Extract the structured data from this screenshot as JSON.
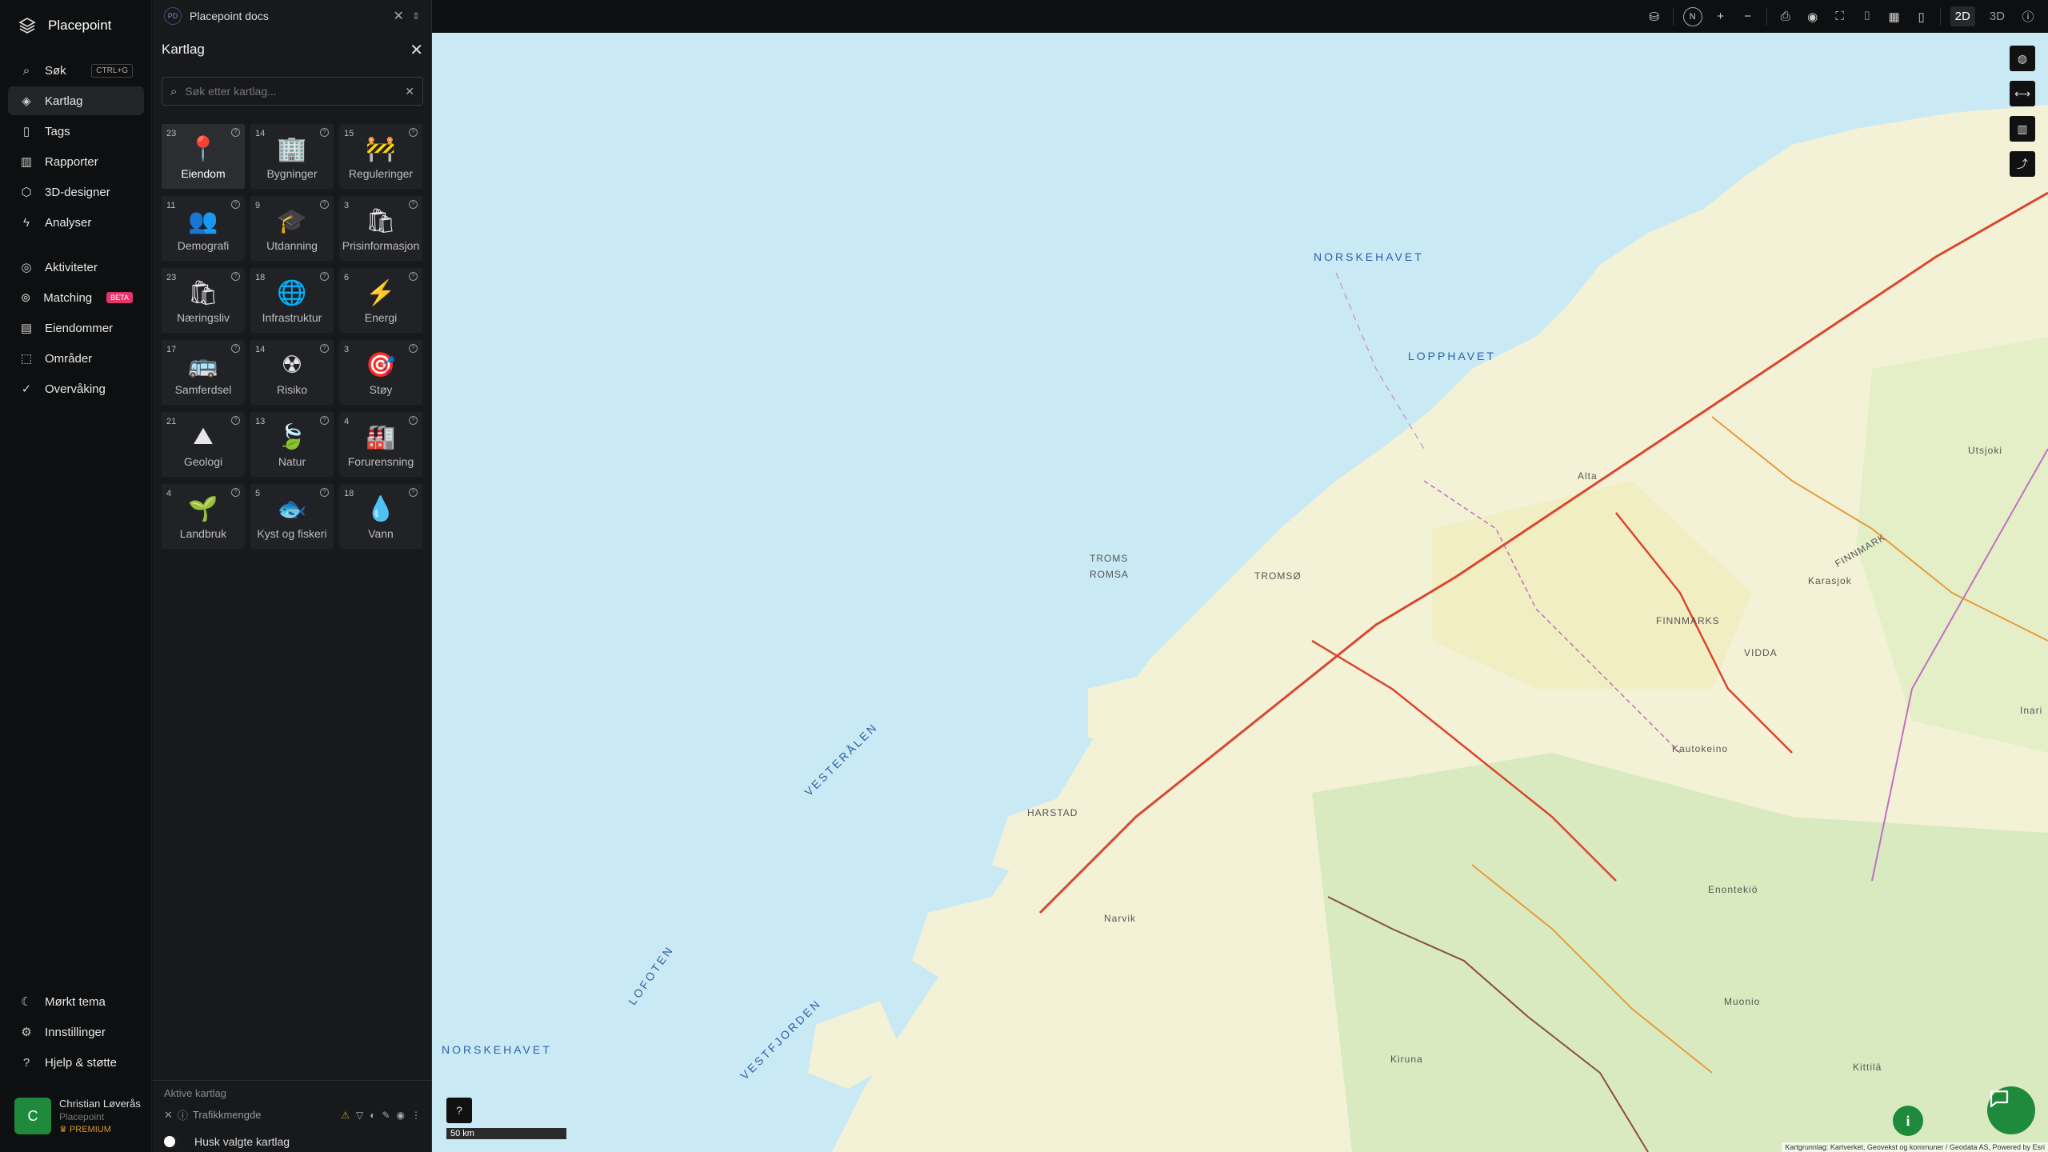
{
  "app": {
    "brand": "Placepoint"
  },
  "nav": {
    "items": [
      {
        "label": "Søk",
        "icon": "search-icon",
        "kbd": "CTRL+G"
      },
      {
        "label": "Kartlag",
        "icon": "layers-icon",
        "active": true
      },
      {
        "label": "Tags",
        "icon": "bookmark-icon"
      },
      {
        "label": "Rapporter",
        "icon": "chart-icon"
      },
      {
        "label": "3D-designer",
        "icon": "cube-icon"
      },
      {
        "label": "Analyser",
        "icon": "bolt-icon"
      }
    ],
    "items2": [
      {
        "label": "Aktiviteter",
        "icon": "activity-icon"
      },
      {
        "label": "Matching",
        "icon": "target-icon",
        "badge": "BETA"
      },
      {
        "label": "Eiendommer",
        "icon": "building-icon"
      },
      {
        "label": "Områder",
        "icon": "area-icon"
      },
      {
        "label": "Overvåking",
        "icon": "check-circle-icon"
      }
    ],
    "bottom": [
      {
        "label": "Mørkt tema",
        "icon": "moon-icon"
      },
      {
        "label": "Innstillinger",
        "icon": "gear-icon"
      },
      {
        "label": "Hjelp & støtte",
        "icon": "help-icon"
      }
    ]
  },
  "user": {
    "initial": "C",
    "name": "Christian Løverås",
    "org": "Placepoint",
    "plan": "PREMIUM"
  },
  "panel": {
    "doc": {
      "badge": "PD",
      "title": "Placepoint docs"
    },
    "title": "Kartlag",
    "search_placeholder": "Søk etter kartlag...",
    "categories": [
      {
        "count": "23",
        "label": "Eiendom",
        "emoji": "📍",
        "selected": true
      },
      {
        "count": "14",
        "label": "Bygninger",
        "emoji": "🏢"
      },
      {
        "count": "15",
        "label": "Reguleringer",
        "emoji": "🚧"
      },
      {
        "count": "11",
        "label": "Demografi",
        "emoji": "👥"
      },
      {
        "count": "9",
        "label": "Utdanning",
        "emoji": "🎓"
      },
      {
        "count": "3",
        "label": "Prisinformasjon",
        "emoji": "🛍"
      },
      {
        "count": "23",
        "label": "Næringsliv",
        "emoji": "🛍"
      },
      {
        "count": "18",
        "label": "Infrastruktur",
        "emoji": "🌐"
      },
      {
        "count": "6",
        "label": "Energi",
        "emoji": "⚡"
      },
      {
        "count": "17",
        "label": "Samferdsel",
        "emoji": "🚌"
      },
      {
        "count": "14",
        "label": "Risiko",
        "emoji": "☢"
      },
      {
        "count": "3",
        "label": "Støy",
        "emoji": "🎯"
      },
      {
        "count": "21",
        "label": "Geologi",
        "emoji": "⛰"
      },
      {
        "count": "13",
        "label": "Natur",
        "emoji": "🍃"
      },
      {
        "count": "4",
        "label": "Forurensning",
        "emoji": "🏭"
      },
      {
        "count": "4",
        "label": "Landbruk",
        "emoji": "🌱"
      },
      {
        "count": "5",
        "label": "Kyst og fiskeri",
        "emoji": "🐟"
      },
      {
        "count": "18",
        "label": "Vann",
        "emoji": "💧"
      }
    ],
    "active": {
      "title": "Aktive kartlag",
      "layer": "Trafikkmengde",
      "remember": "Husk valgte kartlag"
    }
  },
  "topbar": {
    "north": "N",
    "mode_2d": "2D",
    "mode_3d": "3D"
  },
  "map": {
    "labels": [
      {
        "text": "NORSKEHAVET",
        "kind": "sea"
      },
      {
        "text": "LOPPHAVET",
        "kind": "sea"
      },
      {
        "text": "VESTERÅLEN",
        "kind": "sea"
      },
      {
        "text": "LOFOTEN",
        "kind": "sea"
      },
      {
        "text": "NORSKEHAVET",
        "kind": "sea"
      },
      {
        "text": "VESTFJORDEN",
        "kind": "sea"
      },
      {
        "text": "TROMS",
        "kind": "region"
      },
      {
        "text": "ROMSA",
        "kind": "region"
      },
      {
        "text": "FINNMARKS",
        "kind": "region"
      },
      {
        "text": "VIDDA",
        "kind": "region"
      },
      {
        "text": "FINNMARK",
        "kind": "region"
      },
      {
        "text": "TROMSØ",
        "kind": "city"
      },
      {
        "text": "HARSTAD",
        "kind": "city"
      },
      {
        "text": "Narvik",
        "kind": "city"
      },
      {
        "text": "Alta",
        "kind": "city"
      },
      {
        "text": "Karasjok",
        "kind": "city"
      },
      {
        "text": "Kautokeino",
        "kind": "city"
      },
      {
        "text": "Enontekiö",
        "kind": "city"
      },
      {
        "text": "Muonio",
        "kind": "city"
      },
      {
        "text": "Kiruna",
        "kind": "city"
      },
      {
        "text": "Kittilä",
        "kind": "city"
      },
      {
        "text": "Inari",
        "kind": "city"
      },
      {
        "text": "Utsjoki",
        "kind": "city"
      }
    ],
    "scale": "50 km",
    "attribution": "Kartgrunnlag: Kartverket, Geovekst og kommuner / Geodata AS, Powered by Esri"
  },
  "colors": {
    "accent": "#1f8a3b",
    "sea": "#c9eaf4",
    "land": "#f3f1d2",
    "forest": "#d7e9be",
    "road": "#d9462f"
  }
}
